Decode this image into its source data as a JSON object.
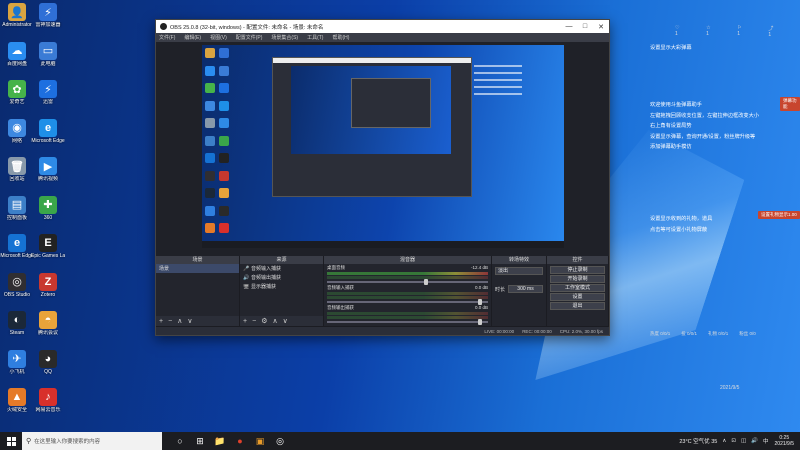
{
  "desktop": {
    "icons": [
      {
        "label": "Administrator",
        "glyph": "👤",
        "color": "#d9a441"
      },
      {
        "label": "雷神加速器",
        "glyph": "⚡",
        "color": "#2f6fd6"
      },
      {
        "label": "百度网盘",
        "glyph": "☁",
        "color": "#2a8df0"
      },
      {
        "label": "此电脑",
        "glyph": "▭",
        "color": "#3a7bd5"
      },
      {
        "label": "爱奇艺",
        "glyph": "✿",
        "color": "#46b34a"
      },
      {
        "label": "迅雷",
        "glyph": "⚡",
        "color": "#1d6fe0"
      },
      {
        "label": "网络",
        "glyph": "◉",
        "color": "#3d88e0"
      },
      {
        "label": "Microsoft Edge",
        "glyph": "e",
        "color": "#1e8fe8"
      },
      {
        "label": "回收站",
        "glyph": "🗑",
        "color": "#8899aa"
      },
      {
        "label": "腾讯视频",
        "glyph": "▶",
        "color": "#2e8ae6"
      },
      {
        "label": "控制面板",
        "glyph": "▤",
        "color": "#3c7fc8"
      },
      {
        "label": "360",
        "glyph": "✚",
        "color": "#3aa64a"
      },
      {
        "label": "Microsoft Edge",
        "glyph": "e",
        "color": "#1572d3"
      },
      {
        "label": "Epic Games Launcher",
        "glyph": "E",
        "color": "#222"
      },
      {
        "label": "OBS Studio",
        "glyph": "◎",
        "color": "#302e31"
      },
      {
        "label": "Zotero",
        "glyph": "Z",
        "color": "#c8382f"
      },
      {
        "label": "Steam",
        "glyph": "◐",
        "color": "#1b2838"
      },
      {
        "label": "腾讯会议",
        "glyph": "◓",
        "color": "#e8a33a"
      },
      {
        "label": "小飞机",
        "glyph": "✈",
        "color": "#2f7fe0"
      },
      {
        "label": "QQ",
        "glyph": "◕",
        "color": "#2a2a2a"
      },
      {
        "label": "火绒安全",
        "glyph": "▲",
        "color": "#e57a28"
      },
      {
        "label": "网易云音乐",
        "glyph": "♪",
        "color": "#d8302b"
      }
    ]
  },
  "obs": {
    "window_title": "OBS 25.0.8 (32-bit, windows) - 配置文件: 未命名 - 场景: 未命名",
    "menu": [
      "文件(F)",
      "编辑(E)",
      "视图(V)",
      "配置文件(P)",
      "场景集合(S)",
      "工具(T)",
      "帮助(H)"
    ],
    "window_buttons": {
      "minimize": "—",
      "maximize": "□",
      "close": "✕"
    },
    "docks": {
      "scenes": {
        "title": "场景",
        "items": [
          "场景"
        ],
        "foot": [
          "+",
          "−",
          "∧",
          "∨"
        ]
      },
      "sources": {
        "title": "来源",
        "items": [
          {
            "icon": "🎤",
            "label": "音频输入捕获"
          },
          {
            "icon": "🔊",
            "label": "音频输出捕获"
          },
          {
            "icon": "🖥",
            "label": "显示器捕获"
          }
        ],
        "foot": [
          "+",
          "−",
          "⚙",
          "∧",
          "∨"
        ]
      },
      "mixer": {
        "title": "混音器",
        "channels": [
          {
            "name": "桌面音频",
            "db": "-12.4 dB"
          },
          {
            "name": "音频输入捕获",
            "db": "0.0 dB"
          },
          {
            "name": "音频输出捕获",
            "db": "0.0 dB"
          }
        ]
      },
      "transitions": {
        "title": "转场特效",
        "type": "淡出",
        "duration_label": "时长",
        "duration": "300 ms"
      },
      "controls": {
        "title": "控件",
        "buttons": [
          "停止录制",
          "开始录制",
          "工作室模式",
          "设置",
          "退出"
        ]
      }
    },
    "status": {
      "live": "LIVE: 00:00:00",
      "rec": "REC: 00:00:00",
      "cpu": "CPU: 2.0%, 30.00 fps"
    }
  },
  "notes": {
    "top_icons": [
      "♡ 1",
      "☆ 1",
      "⚐ 1",
      "⤴ 1"
    ],
    "line1": "设置显示大彩弹幕",
    "block": [
      "欢迎使用斗鱼弹幕助手",
      "左键拖拽回顾收支位置，左键拉伸边框改变大小",
      "右上角有设置局势",
      "设置显示弹幕，查询开通/设置，粉丝牌升级等",
      "添加弹幕助手模仿"
    ],
    "block2": [
      "设置显示收到的礼物，道具",
      "点击等可设置小礼物屏蔽"
    ],
    "tag1": "弹幕功能",
    "tag2": "设置礼物显示1.00",
    "bottom_stats": [
      "热度 0/0/1",
      "投 0/0/1",
      "礼物 0/0/1",
      "粉丝 0/0"
    ],
    "date": "2021/9/5"
  },
  "taskbar": {
    "search_placeholder": "在这里输入你要搜索的内容",
    "apps": [
      "○",
      "⊞",
      "📁",
      "●",
      "▣",
      "◎"
    ],
    "weather": "23°C 空气优 35",
    "tray": [
      "∧",
      "⊡",
      "◫",
      "🔊",
      "中"
    ],
    "time": "0:25",
    "date": "2021/9/5"
  },
  "colors": {
    "obs_panel": "#2b2e38",
    "obs_header": "#3a3d47",
    "taskbar": "#1c1d21",
    "tag_red": "#c8452e"
  }
}
